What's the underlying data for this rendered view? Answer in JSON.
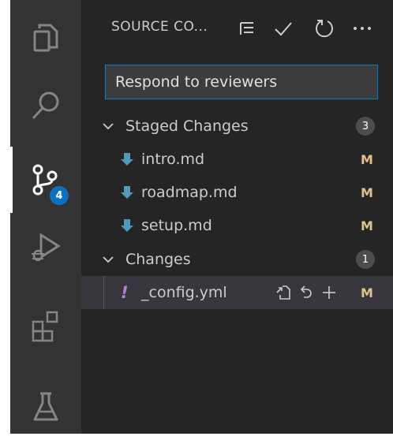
{
  "header": {
    "title": "SOURCE CO..."
  },
  "activity": {
    "scm_badge": "4"
  },
  "commit": {
    "message": "Respond to reviewers"
  },
  "staged": {
    "label": "Staged Changes",
    "count": "3",
    "files": [
      {
        "name": "intro.md",
        "status": "M"
      },
      {
        "name": "roadmap.md",
        "status": "M"
      },
      {
        "name": "setup.md",
        "status": "M"
      }
    ]
  },
  "changes": {
    "label": "Changes",
    "count": "1",
    "files": [
      {
        "marker": "!",
        "name": "_config.yml",
        "status": "M"
      }
    ]
  },
  "colors": {
    "sidebar_bg": "#252526",
    "activity_bg": "#333333",
    "accent": "#0e70c0",
    "modified": "#e2c08d",
    "warning_marker": "#b180d7"
  }
}
